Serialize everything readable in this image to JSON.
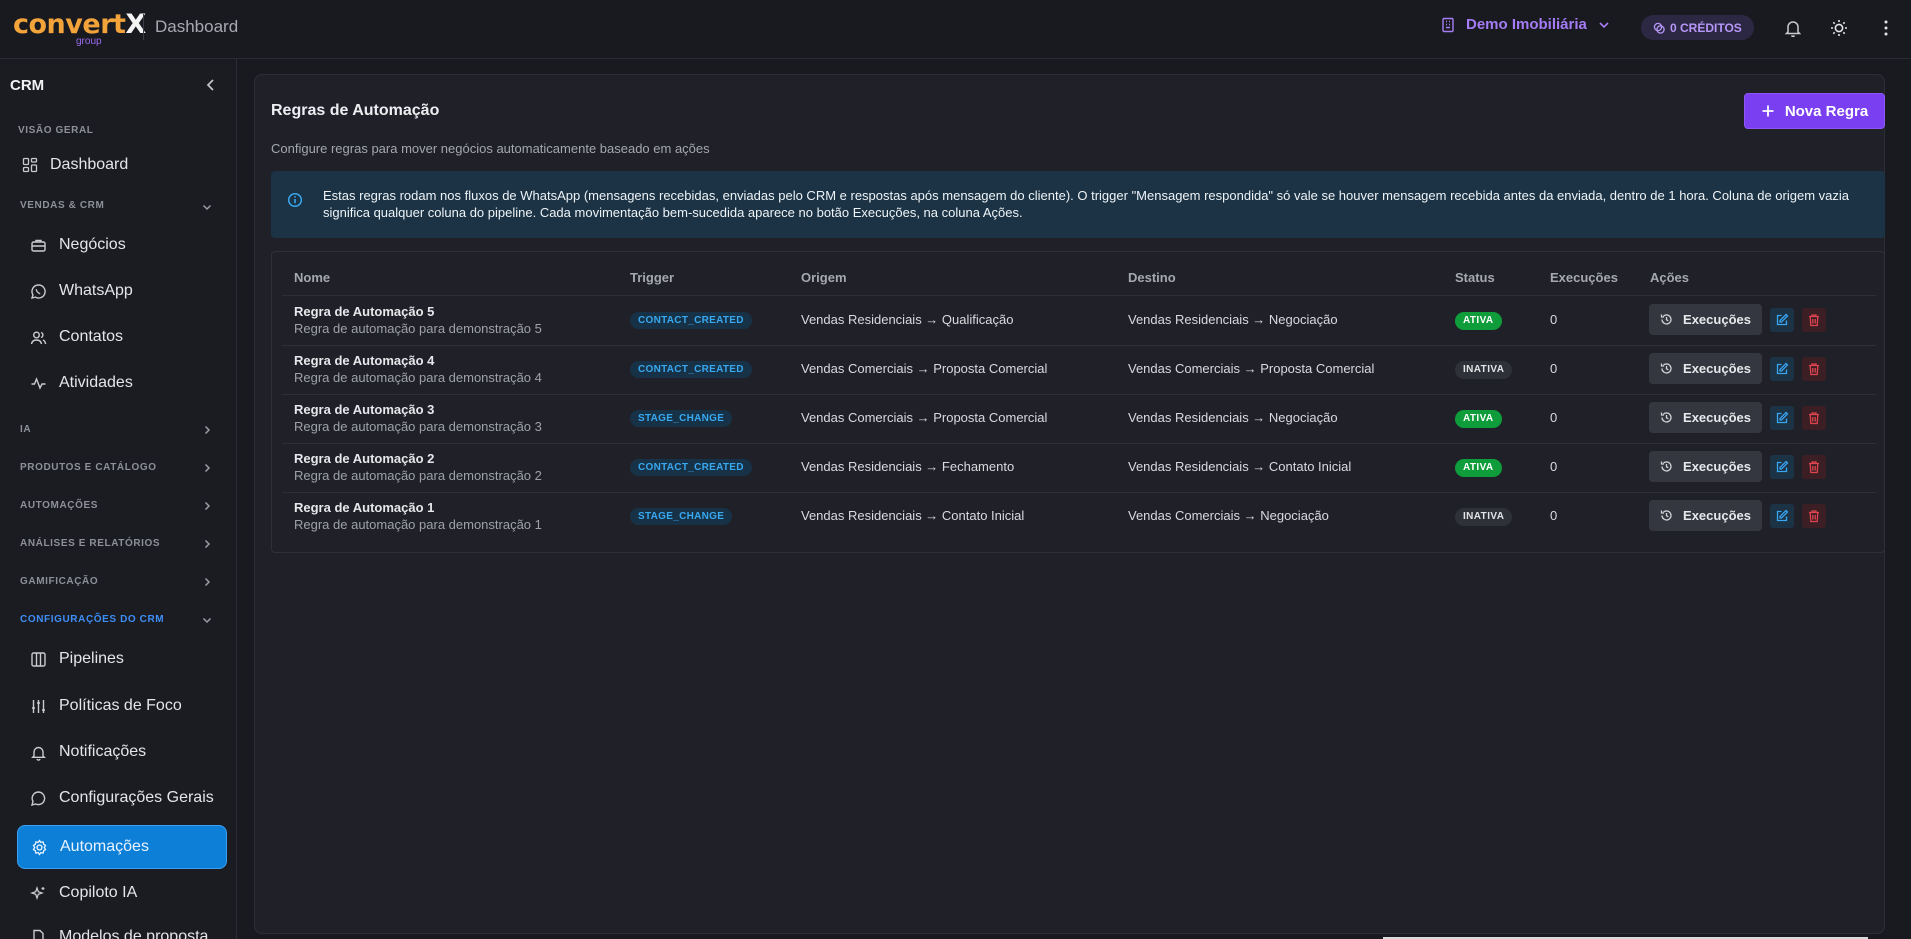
{
  "header": {
    "logo_text_main": "convert",
    "logo_text_x": "X",
    "logo_text_group": "group",
    "page_title": "Dashboard",
    "company": "Demo Imobiliária",
    "credits": "0 CRÉDITOS"
  },
  "sidebar": {
    "title": "CRM",
    "sections": {
      "overview": "VISÃO GERAL",
      "sales": "VENDAS & CRM",
      "ai": "IA",
      "products": "PRODUTOS E CATÁLOGO",
      "automations": "AUTOMAÇÕES",
      "analytics": "ANÁLISES E RELATÓRIOS",
      "gamification": "GAMIFICAÇÃO",
      "crm_settings": "CONFIGURAÇÕES DO CRM"
    },
    "items": {
      "dashboard": "Dashboard",
      "deals": "Negócios",
      "whatsapp": "WhatsApp",
      "contacts": "Contatos",
      "activities": "Atividades",
      "pipelines": "Pipelines",
      "focus_policies": "Políticas de Foco",
      "notifications": "Notificações",
      "general_settings": "Configurações Gerais",
      "automations": "Automações",
      "copilot": "Copiloto IA",
      "proposal_models": "Modelos de proposta"
    }
  },
  "main": {
    "title": "Regras de Automação",
    "subtitle": "Configure regras para mover negócios automaticamente baseado em ações",
    "new_button": "Nova Regra",
    "info": "Estas regras rodam nos fluxos de WhatsApp (mensagens recebidas, enviadas pelo CRM e respostas após mensagem do cliente). O trigger \"Mensagem respondida\" só vale se houver mensagem recebida antes da enviada, dentro de 1 hora. Coluna de origem vazia significa qualquer coluna do pipeline. Cada movimentação bem-sucedida aparece no botão Execuções, na coluna Ações.",
    "columns": {
      "name": "Nome",
      "trigger": "Trigger",
      "origin": "Origem",
      "destination": "Destino",
      "status": "Status",
      "executions": "Execuções",
      "actions": "Ações"
    },
    "exec_button": "Execuções",
    "rows": [
      {
        "name": "Regra de Automação 5",
        "desc": "Regra de automação para demonstração 5",
        "trigger": "CONTACT_CREATED",
        "origin": "Vendas Residenciais → Qualificação",
        "destination": "Vendas Residenciais → Negociação",
        "status": "ATIVA",
        "executions": "0"
      },
      {
        "name": "Regra de Automação 4",
        "desc": "Regra de automação para demonstração 4",
        "trigger": "CONTACT_CREATED",
        "origin": "Vendas Comerciais → Proposta Comercial",
        "destination": "Vendas Comerciais → Proposta Comercial",
        "status": "INATIVA",
        "executions": "0"
      },
      {
        "name": "Regra de Automação 3",
        "desc": "Regra de automação para demonstração 3",
        "trigger": "STAGE_CHANGE",
        "origin": "Vendas Comerciais → Proposta Comercial",
        "destination": "Vendas Residenciais → Negociação",
        "status": "ATIVA",
        "executions": "0"
      },
      {
        "name": "Regra de Automação 2",
        "desc": "Regra de automação para demonstração 2",
        "trigger": "CONTACT_CREATED",
        "origin": "Vendas Residenciais → Fechamento",
        "destination": "Vendas Residenciais → Contato Inicial",
        "status": "ATIVA",
        "executions": "0"
      },
      {
        "name": "Regra de Automação 1",
        "desc": "Regra de automação para demonstração 1",
        "trigger": "STAGE_CHANGE",
        "origin": "Vendas Residenciais → Contato Inicial",
        "destination": "Vendas Comerciais → Negociação",
        "status": "INATIVA",
        "executions": "0"
      }
    ]
  },
  "colors": {
    "accent_purple": "#7a3ff0",
    "active_blue": "#0e7fd6",
    "status_active": "#0f9d3b",
    "trigger_blue": "#38a8f0",
    "delete_red": "#e0444f"
  }
}
